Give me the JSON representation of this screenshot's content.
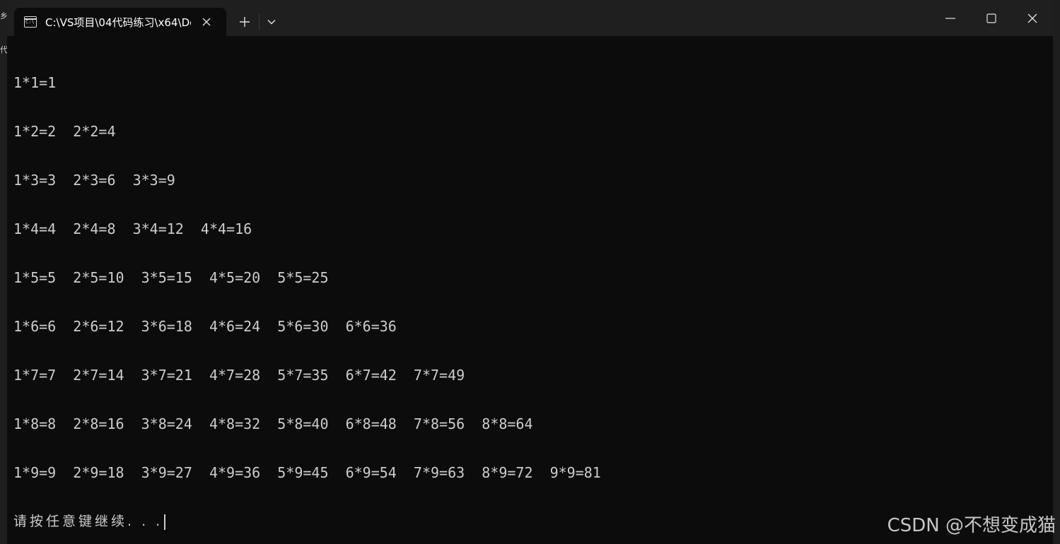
{
  "window": {
    "tab_title": "C:\\VS项目\\04代码练习\\x64\\De",
    "tab_icon": "console-icon",
    "tab_icon_glyph": "C:\\",
    "new_tab_icon": "plus-icon",
    "dropdown_icon": "chevron-down-icon",
    "minimize_icon": "minimize-icon",
    "maximize_icon": "maximize-icon",
    "close_icon": "close-icon"
  },
  "background": {
    "left_glyph_1": "乡",
    "left_glyph_2": "代"
  },
  "console": {
    "lines": [
      "1*1=1",
      "1*2=2  2*2=4",
      "1*3=3  2*3=6  3*3=9",
      "1*4=4  2*4=8  3*4=12  4*4=16",
      "1*5=5  2*5=10  3*5=15  4*5=20  5*5=25",
      "1*6=6  2*6=12  3*6=18  4*6=24  5*6=30  6*6=36",
      "1*7=7  2*7=14  3*7=21  4*7=28  5*7=35  6*7=42  7*7=49",
      "1*8=8  2*8=16  3*8=24  4*8=32  5*8=40  6*8=48  7*8=56  8*8=64",
      "1*9=9  2*9=18  3*9=27  4*9=36  5*9=45  6*9=54  7*9=63  8*9=72  9*9=81"
    ],
    "prompt": "请按任意键继续. . ."
  },
  "watermark": "CSDN @不想变成猫",
  "colors": {
    "console_bg": "#0c0c0c",
    "console_text": "#cccccc",
    "titlebar_bg": "#1f1f1f"
  }
}
